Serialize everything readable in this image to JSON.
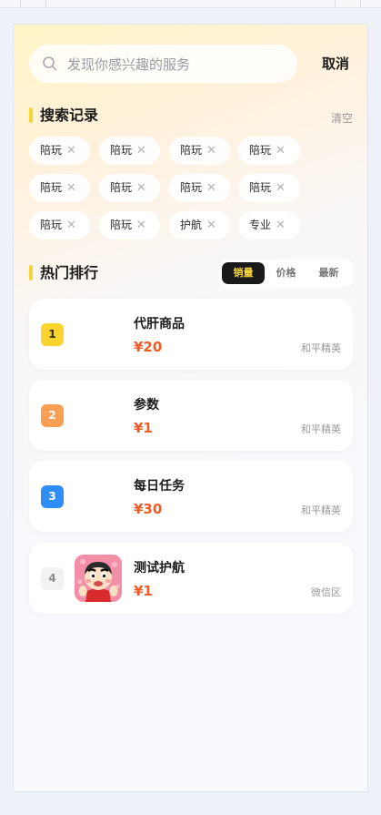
{
  "search": {
    "placeholder": "发现你感兴趣的服务",
    "value": "",
    "cancel_label": "取消"
  },
  "history": {
    "title": "搜索记录",
    "clear_label": "清空",
    "tags": [
      "陪玩",
      "陪玩",
      "陪玩",
      "陪玩",
      "陪玩",
      "陪玩",
      "陪玩",
      "陪玩",
      "陪玩",
      "陪玩",
      "护航",
      "专业"
    ],
    "remove_glyph": "✕"
  },
  "ranking": {
    "title": "热门排行",
    "sort_tabs": [
      "销量",
      "价格",
      "最新"
    ],
    "active_tab": "销量",
    "items": [
      {
        "rank": "1",
        "title": "代肝商品",
        "price": "¥20",
        "zone": "和平精英",
        "rank_color": "#f9d42f",
        "rank_text_color": "#3a2a00",
        "has_image": false
      },
      {
        "rank": "2",
        "title": "参数",
        "price": "¥1",
        "zone": "和平精英",
        "rank_color": "#f7a053",
        "rank_text_color": "#ffffff",
        "has_image": false
      },
      {
        "rank": "3",
        "title": "每日任务",
        "price": "¥30",
        "zone": "和平精英",
        "rank_color": "#2f8ef5",
        "rank_text_color": "#ffffff",
        "has_image": false
      },
      {
        "rank": "4",
        "title": "测试护航",
        "price": "¥1",
        "zone": "微信区",
        "rank_color": "#f2f2f4",
        "rank_text_color": "#8d8d8d",
        "has_image": true
      }
    ]
  },
  "colors": {
    "accent_yellow": "#f5d437",
    "price_red": "#f05a23",
    "dark": "#1a1a1a"
  }
}
